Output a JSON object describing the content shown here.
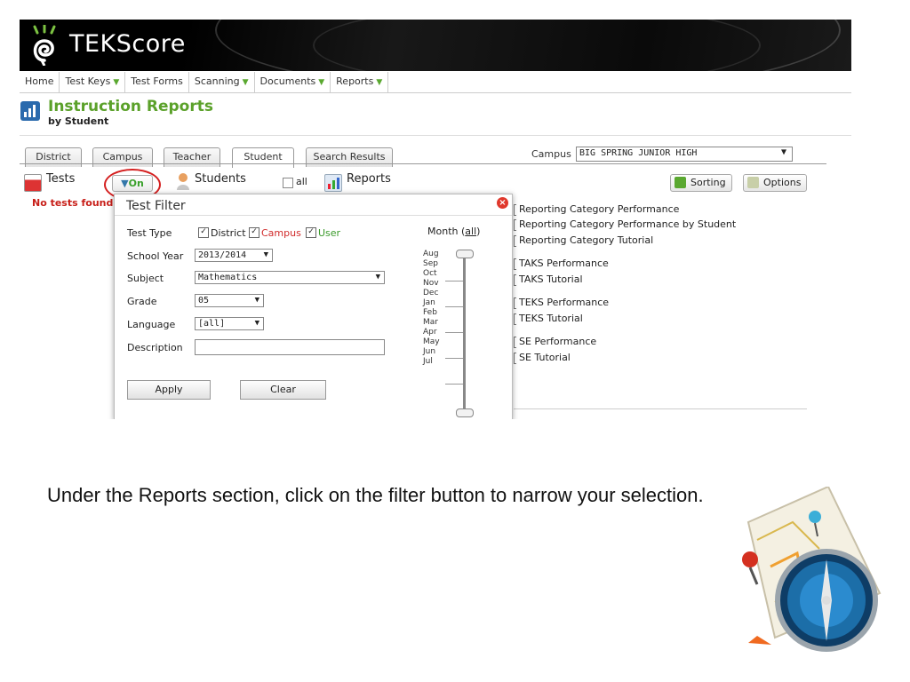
{
  "app": {
    "name": "TEKScore"
  },
  "nav": {
    "items": [
      {
        "label": "Home",
        "dropdown": false
      },
      {
        "label": "Test Keys",
        "dropdown": true
      },
      {
        "label": "Test Forms",
        "dropdown": false
      },
      {
        "label": "Scanning",
        "dropdown": true
      },
      {
        "label": "Documents",
        "dropdown": true
      },
      {
        "label": "Reports",
        "dropdown": true
      }
    ]
  },
  "page": {
    "title": "Instruction Reports",
    "subtitle": "by Student"
  },
  "tabs": [
    "District",
    "Campus",
    "Teacher",
    "Student",
    "Search Results"
  ],
  "active_tab": "Student",
  "campus": {
    "label": "Campus",
    "value": "BIG SPRING JUNIOR HIGH"
  },
  "toolbar": {
    "tests_label": "Tests",
    "filter_label": "On",
    "students_label": "Students",
    "all_label": "all",
    "reports_label": "Reports",
    "sorting_label": "Sorting",
    "options_label": "Options"
  },
  "status": {
    "no_tests": "No tests found"
  },
  "filter": {
    "title": "Test Filter",
    "test_type_label": "Test Type",
    "types": [
      {
        "label": "District",
        "checked": true,
        "color": "#222222"
      },
      {
        "label": "Campus",
        "checked": true,
        "color": "#d02a2a"
      },
      {
        "label": "User",
        "checked": true,
        "color": "#3a9a2a"
      }
    ],
    "school_year_label": "School Year",
    "school_year": "2013/2014",
    "subject_label": "Subject",
    "subject": "Mathematics",
    "grade_label": "Grade",
    "grade": "05",
    "language_label": "Language",
    "language": "[all]",
    "description_label": "Description",
    "description": "",
    "apply_label": "Apply",
    "clear_label": "Clear",
    "month_label": "Month (",
    "month_all": "all",
    "month_close": ")",
    "months": [
      "Aug",
      "Sep",
      "Oct",
      "Nov",
      "Dec",
      "Jan",
      "Feb",
      "Mar",
      "Apr",
      "May",
      "Jun",
      "Jul"
    ],
    "month_range": [
      "Aug",
      "Jul"
    ]
  },
  "reports": [
    "Reporting Category Performance",
    "Reporting Category Performance by Student",
    "Reporting Category Tutorial",
    "TAKS Performance",
    "TAKS Tutorial",
    "TEKS Performance",
    "TEKS Tutorial",
    "SE Performance",
    "SE Tutorial"
  ],
  "caption": "Under the Reports section, click on the filter button to narrow your selection.",
  "colors": {
    "accent_green": "#5ba12a",
    "highlight_red": "#d42020",
    "tab_border": "#999999"
  }
}
